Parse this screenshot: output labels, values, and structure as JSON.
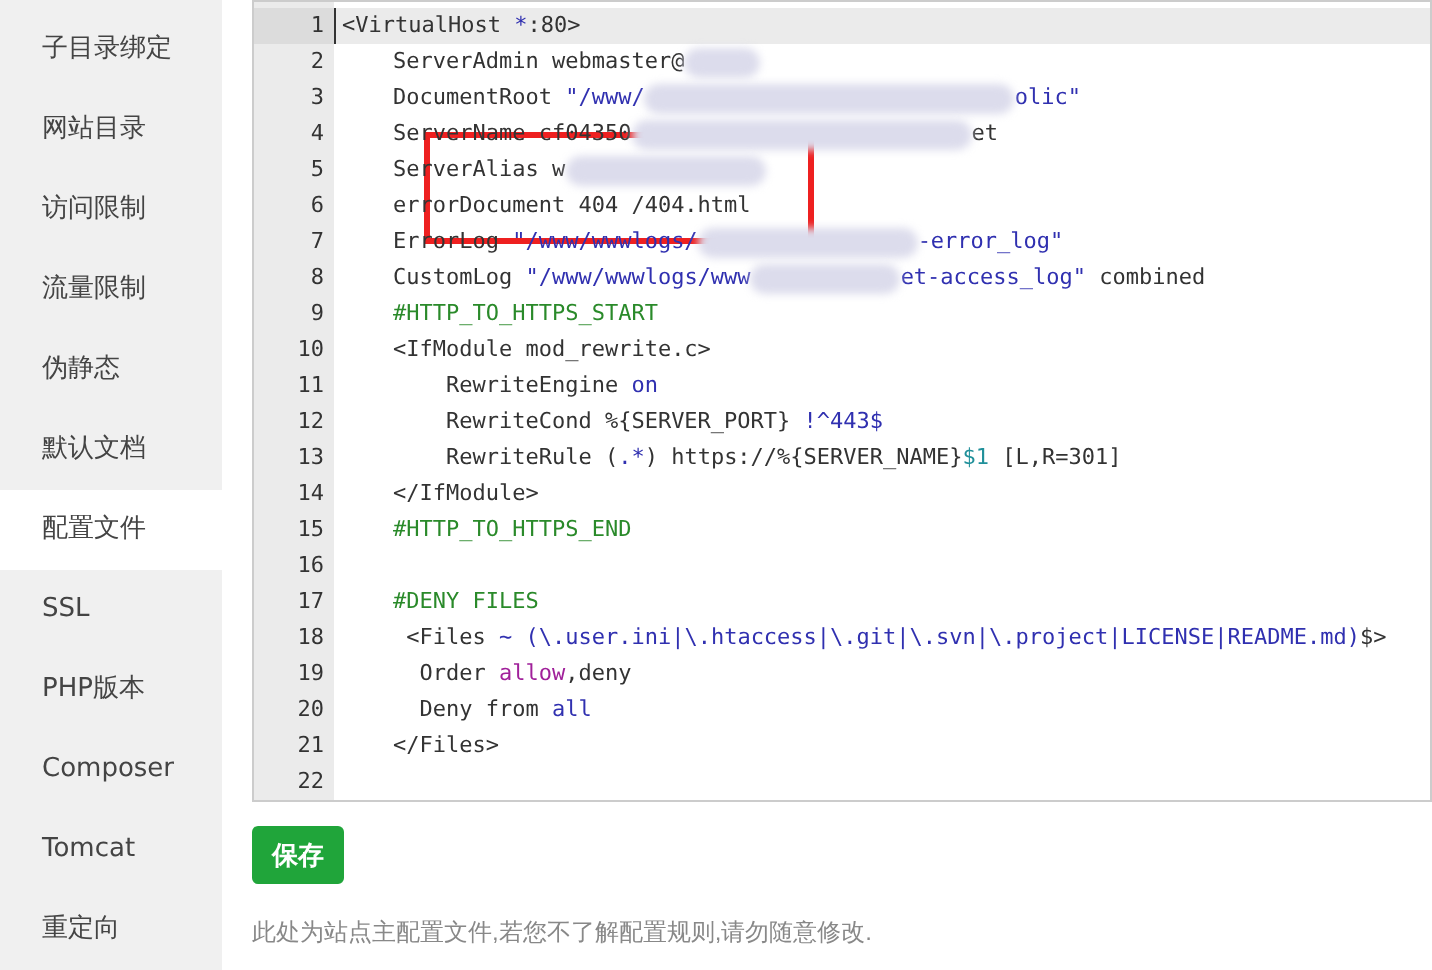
{
  "sidebar": {
    "items": [
      {
        "label": "子目录绑定",
        "selected": false
      },
      {
        "label": "网站目录",
        "selected": false
      },
      {
        "label": "访问限制",
        "selected": false
      },
      {
        "label": "流量限制",
        "selected": false
      },
      {
        "label": "伪静态",
        "selected": false
      },
      {
        "label": "默认文档",
        "selected": false
      },
      {
        "label": "配置文件",
        "selected": true
      },
      {
        "label": "SSL",
        "selected": false
      },
      {
        "label": "PHP版本",
        "selected": false
      },
      {
        "label": "Composer",
        "selected": false
      },
      {
        "label": "Tomcat",
        "selected": false
      },
      {
        "label": "重定向",
        "selected": false
      }
    ]
  },
  "editor": {
    "lines": [
      {
        "number": "1",
        "active": true,
        "tokens": [
          {
            "kind": "plain",
            "text": "<VirtualHost "
          },
          {
            "kind": "string",
            "text": "*"
          },
          {
            "kind": "plain",
            "text": ":80>"
          }
        ]
      },
      {
        "number": "2",
        "active": false,
        "tokens": [
          {
            "kind": "plain",
            "text": "    ServerAdmin webmaster@"
          },
          {
            "kind": "redacted"
          }
        ]
      },
      {
        "number": "3",
        "active": false,
        "tokens": [
          {
            "kind": "plain",
            "text": "    DocumentRoot "
          },
          {
            "kind": "string",
            "text": "\"/www/"
          },
          {
            "kind": "redacted"
          },
          {
            "kind": "string",
            "text": "olic\""
          }
        ]
      },
      {
        "number": "4",
        "active": false,
        "tokens": [
          {
            "kind": "plain",
            "text": "    ServerName cf04350"
          },
          {
            "kind": "redacted"
          },
          {
            "kind": "plain",
            "text": "et"
          }
        ]
      },
      {
        "number": "5",
        "active": false,
        "tokens": [
          {
            "kind": "plain",
            "text": "    ServerAlias w"
          },
          {
            "kind": "redacted"
          }
        ]
      },
      {
        "number": "6",
        "active": false,
        "tokens": [
          {
            "kind": "plain",
            "text": "    errorDocument 404 /404.html"
          }
        ]
      },
      {
        "number": "7",
        "active": false,
        "tokens": [
          {
            "kind": "plain",
            "text": "    ErrorLog "
          },
          {
            "kind": "string",
            "text": "\"/www/wwwlogs/"
          },
          {
            "kind": "redacted"
          },
          {
            "kind": "string",
            "text": "-error_log\""
          }
        ]
      },
      {
        "number": "8",
        "active": false,
        "tokens": [
          {
            "kind": "plain",
            "text": "    CustomLog "
          },
          {
            "kind": "string",
            "text": "\"/www/wwwlogs/www"
          },
          {
            "kind": "redacted"
          },
          {
            "kind": "string",
            "text": "et-access_log\""
          },
          {
            "kind": "plain",
            "text": " combined"
          }
        ]
      },
      {
        "number": "9",
        "active": false,
        "tokens": [
          {
            "kind": "comment",
            "text": "    #HTTP_TO_HTTPS_START"
          }
        ]
      },
      {
        "number": "10",
        "active": false,
        "tokens": [
          {
            "kind": "plain",
            "text": "    <IfModule mod_rewrite.c>"
          }
        ]
      },
      {
        "number": "11",
        "active": false,
        "tokens": [
          {
            "kind": "plain",
            "text": "        RewriteEngine "
          },
          {
            "kind": "string",
            "text": "on"
          }
        ]
      },
      {
        "number": "12",
        "active": false,
        "tokens": [
          {
            "kind": "plain",
            "text": "        RewriteCond %{SERVER_PORT} "
          },
          {
            "kind": "string",
            "text": "!^443$"
          }
        ]
      },
      {
        "number": "13",
        "active": false,
        "tokens": [
          {
            "kind": "plain",
            "text": "        RewriteRule ("
          },
          {
            "kind": "string",
            "text": ".*"
          },
          {
            "kind": "plain",
            "text": ") https://%{SERVER_NAME}"
          },
          {
            "kind": "variable",
            "text": "$1"
          },
          {
            "kind": "plain",
            "text": " [L,R=301]"
          }
        ]
      },
      {
        "number": "14",
        "active": false,
        "tokens": [
          {
            "kind": "plain",
            "text": "    </IfModule>"
          }
        ]
      },
      {
        "number": "15",
        "active": false,
        "tokens": [
          {
            "kind": "comment",
            "text": "    #HTTP_TO_HTTPS_END"
          }
        ]
      },
      {
        "number": "16",
        "active": false
      },
      {
        "number": "17",
        "active": false,
        "tokens": [
          {
            "kind": "comment",
            "text": "    #DENY FILES"
          }
        ]
      },
      {
        "number": "18",
        "active": false,
        "tokens": [
          {
            "kind": "plain",
            "text": "     <Files "
          },
          {
            "kind": "string",
            "text": "~ (\\.user.ini|\\.htaccess|\\.git|\\.svn|\\.project|LICENSE|README.md)"
          },
          {
            "kind": "plain",
            "text": "$>"
          }
        ]
      },
      {
        "number": "19",
        "active": false,
        "tokens": [
          {
            "kind": "plain",
            "text": "      Order "
          },
          {
            "kind": "keyword",
            "text": "allow"
          },
          {
            "kind": "plain",
            "text": ",deny"
          }
        ]
      },
      {
        "number": "20",
        "active": false,
        "tokens": [
          {
            "kind": "plain",
            "text": "      Deny from "
          },
          {
            "kind": "string",
            "text": "all"
          }
        ]
      },
      {
        "number": "21",
        "active": false,
        "tokens": [
          {
            "kind": "plain",
            "text": "    </Files>"
          }
        ]
      },
      {
        "number": "22",
        "active": false
      }
    ]
  },
  "save_button": "保存",
  "note": "此处为站点主配置文件,若您不了解配置规则,请勿随意修改."
}
